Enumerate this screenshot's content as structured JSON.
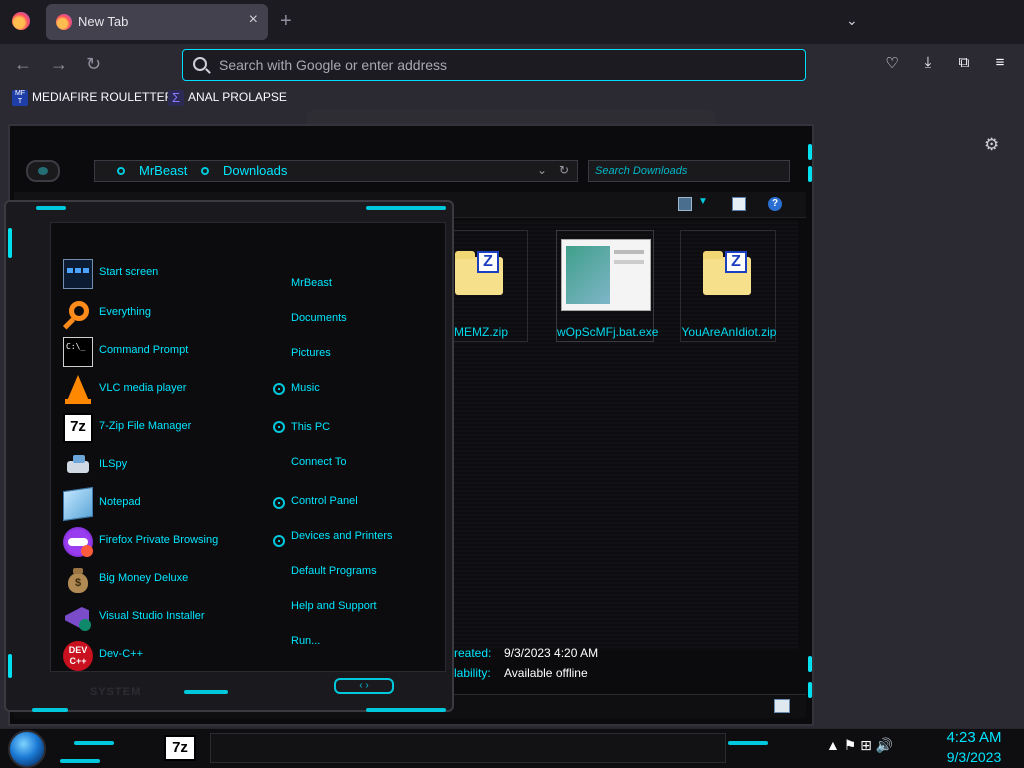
{
  "browser": {
    "tab_title": "New Tab",
    "tab_close": "×",
    "new_tab": "+",
    "tab_list": "⌄",
    "urlbar_placeholder": "Search with Google or enter address",
    "nav": {
      "back": "←",
      "forward": "→",
      "reload": "↻"
    },
    "toolbar_right": {
      "pocket": "♡",
      "downloads": "⤓",
      "extensions": "⧉",
      "menu": "≡"
    },
    "bookmarks": [
      {
        "label": "MEDIAFIRE ROULETTER",
        "icon": "MF T"
      },
      {
        "label": "ANAL PROLAPSE",
        "icon": "Σ"
      }
    ],
    "settings_icon": "⚙"
  },
  "explorer": {
    "path": [
      "MrBeast",
      "Downloads"
    ],
    "search_placeholder": "Search Downloads",
    "files": [
      {
        "name": "MEMZ.zip",
        "kind": "zip"
      },
      {
        "name": "wOpScMFj.bat.exe",
        "kind": "exe"
      },
      {
        "name": "YouAreAnIdiot.zip",
        "kind": "zip"
      }
    ],
    "details": {
      "created_label": "reated:",
      "created_value": "9/3/2023 4:20 AM",
      "availability_label": "lability:",
      "availability_value": "Available offline"
    }
  },
  "start_menu": {
    "programs": [
      {
        "name": "Start screen",
        "icon": "start-screen-icon",
        "has_arrow": false
      },
      {
        "name": "Everything",
        "icon": "magnifier-icon",
        "has_arrow": false
      },
      {
        "name": "Command Prompt",
        "icon": "cmd-icon",
        "has_arrow": false
      },
      {
        "name": "VLC media player",
        "icon": "vlc-icon",
        "has_arrow": true
      },
      {
        "name": "7-Zip File Manager",
        "icon": "7zip-icon",
        "has_arrow": true
      },
      {
        "name": "ILSpy",
        "icon": "ilspy-icon",
        "has_arrow": false
      },
      {
        "name": "Notepad",
        "icon": "notepad-icon",
        "has_arrow": true
      },
      {
        "name": "Firefox Private Browsing",
        "icon": "firefox-private-icon",
        "has_arrow": true
      },
      {
        "name": "Big Money Deluxe",
        "icon": "money-bag-icon",
        "has_arrow": false
      },
      {
        "name": "Visual Studio Installer",
        "icon": "visual-studio-icon",
        "has_arrow": false
      },
      {
        "name": "Dev-C++",
        "icon": "devcpp-icon",
        "has_arrow": false
      }
    ],
    "places": [
      "MrBeast",
      "Documents",
      "Pictures",
      "Music",
      "This PC",
      "Connect To",
      "Control Panel",
      "Devices and Printers",
      "Default Programs",
      "Help and Support",
      "Run..."
    ],
    "system_label": "SYSTEM",
    "nav_label": "‹  ›"
  },
  "taskbar": {
    "pinned_7z": "7z",
    "clock_time": "4:23 AM",
    "clock_date": "9/3/2023",
    "tray": "▲  ⚑  ⊞  🔊"
  }
}
